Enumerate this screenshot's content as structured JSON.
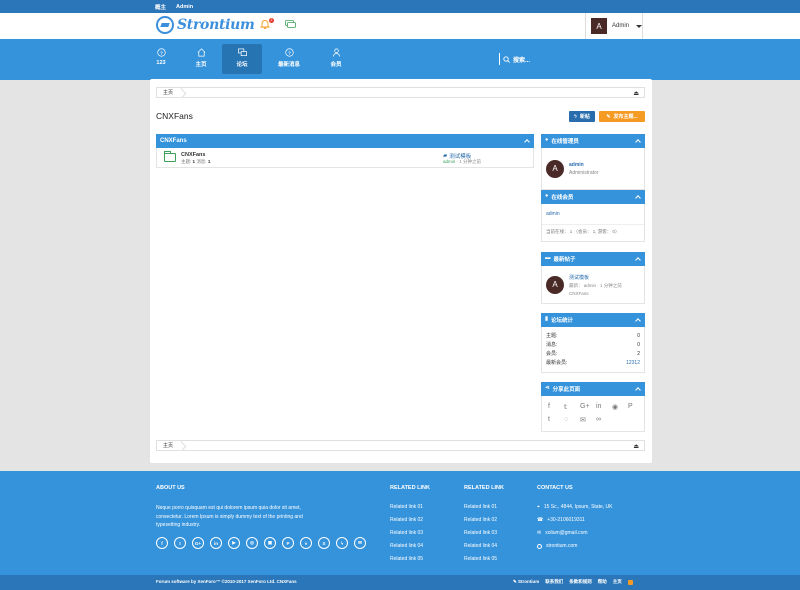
{
  "topbar": {
    "menu": "概主",
    "admin": "Admin"
  },
  "header": {
    "logo_text": "Strontium",
    "notif_count": "2",
    "user": "Admin",
    "avatar_letter": "A"
  },
  "nav": {
    "items": [
      {
        "label": "123"
      },
      {
        "label": "主页"
      },
      {
        "label": "论坛"
      },
      {
        "label": "最新消息"
      },
      {
        "label": "会员"
      }
    ],
    "search_label": "搜索..."
  },
  "breadcrumb": {
    "home": "主页"
  },
  "page": {
    "title": "CNXFans",
    "btn_new": "新帖",
    "btn_post": "发布主题..."
  },
  "forum": {
    "category": "CNXFans",
    "row": {
      "name": "CNXFans",
      "stats_label1": "主题:",
      "stats_val1": "1",
      "stats_label2": "消息:",
      "stats_val2": "1",
      "last_title": "测试模板",
      "last_user": "admin",
      "last_time": "· 1 分钟之前"
    }
  },
  "sidebar": {
    "staff": {
      "title": "在线管理员",
      "name": "admin",
      "role": "Administrator",
      "avatar_letter": "A"
    },
    "members": {
      "title": "在线会员",
      "name": "admin",
      "summary": "当前在线： 1 （会员： 1, 游客： 0）"
    },
    "latest": {
      "title": "最新帖子",
      "post_title": "测试模板",
      "post_meta": "最新： admin · 1 分钟之前",
      "forum": "CNXFans",
      "avatar_letter": "A"
    },
    "stats": {
      "title": "论坛统计",
      "rows": [
        {
          "label": "主题:",
          "value": "0"
        },
        {
          "label": "消息:",
          "value": "0"
        },
        {
          "label": "会员:",
          "value": "2"
        },
        {
          "label": "最新会员:",
          "value": "12312"
        }
      ]
    },
    "share": {
      "title": "分享此页面"
    }
  },
  "footer": {
    "about_title": "ABOUT US",
    "about_text": "Neque porro quisquam est qui dolorem ipsum quia dolor sit amet, consectetur. Lorem Ipsum is simply dummy text of the printing and typesetting industry.",
    "related1_title": "RELATED LINK",
    "related1": [
      "Related link 01",
      "Related link 02",
      "Related link 03",
      "Related link 04",
      "Related link 05"
    ],
    "related2_title": "RELATED LINK",
    "related2": [
      "Related link 01",
      "Related link 02",
      "Related link 03",
      "Related link 04",
      "Related link 05"
    ],
    "contact_title": "CONTACT US",
    "contact": [
      "15 Sc., 4844, Ipsum, State, UK",
      "+30-2106019311",
      "xolium@gmail.com",
      "strontium.com"
    ],
    "copyright": "Forum software by XenForo™ ©2010-2017 XenForo Ltd. CNXFans",
    "bottom_links": [
      "Strontium",
      "联系我们",
      "条款和规则",
      "帮助",
      "主页"
    ]
  }
}
